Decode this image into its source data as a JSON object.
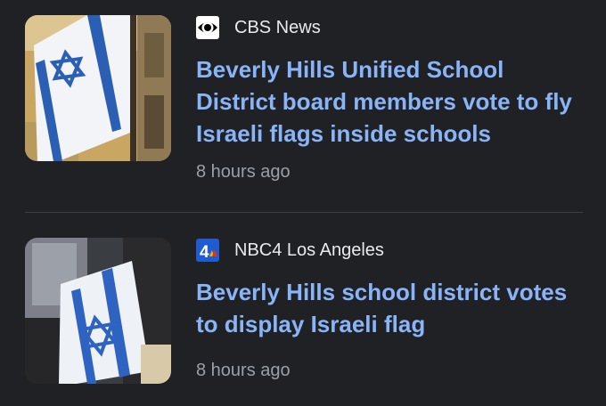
{
  "theme": {
    "background": "#202124",
    "headline_color": "#8ab4f8",
    "source_color": "#e8eaed",
    "timestamp_color": "#9aa0a6",
    "divider_color": "#3c4043"
  },
  "articles": [
    {
      "source": "CBS News",
      "source_icon": "cbs-eye-logo-icon",
      "headline": "Beverly Hills Unified School District board members vote to fly Israeli flags inside schools",
      "time": "8 hours ago",
      "thumbnail": "israeli-flag-on-building-photo"
    },
    {
      "source": "NBC4 Los Angeles",
      "source_icon": "nbc4-logo-icon",
      "headline": "Beverly Hills school district votes to display Israeli flag",
      "time": "8 hours ago",
      "thumbnail": "israeli-flag-held-by-person-photo"
    }
  ]
}
